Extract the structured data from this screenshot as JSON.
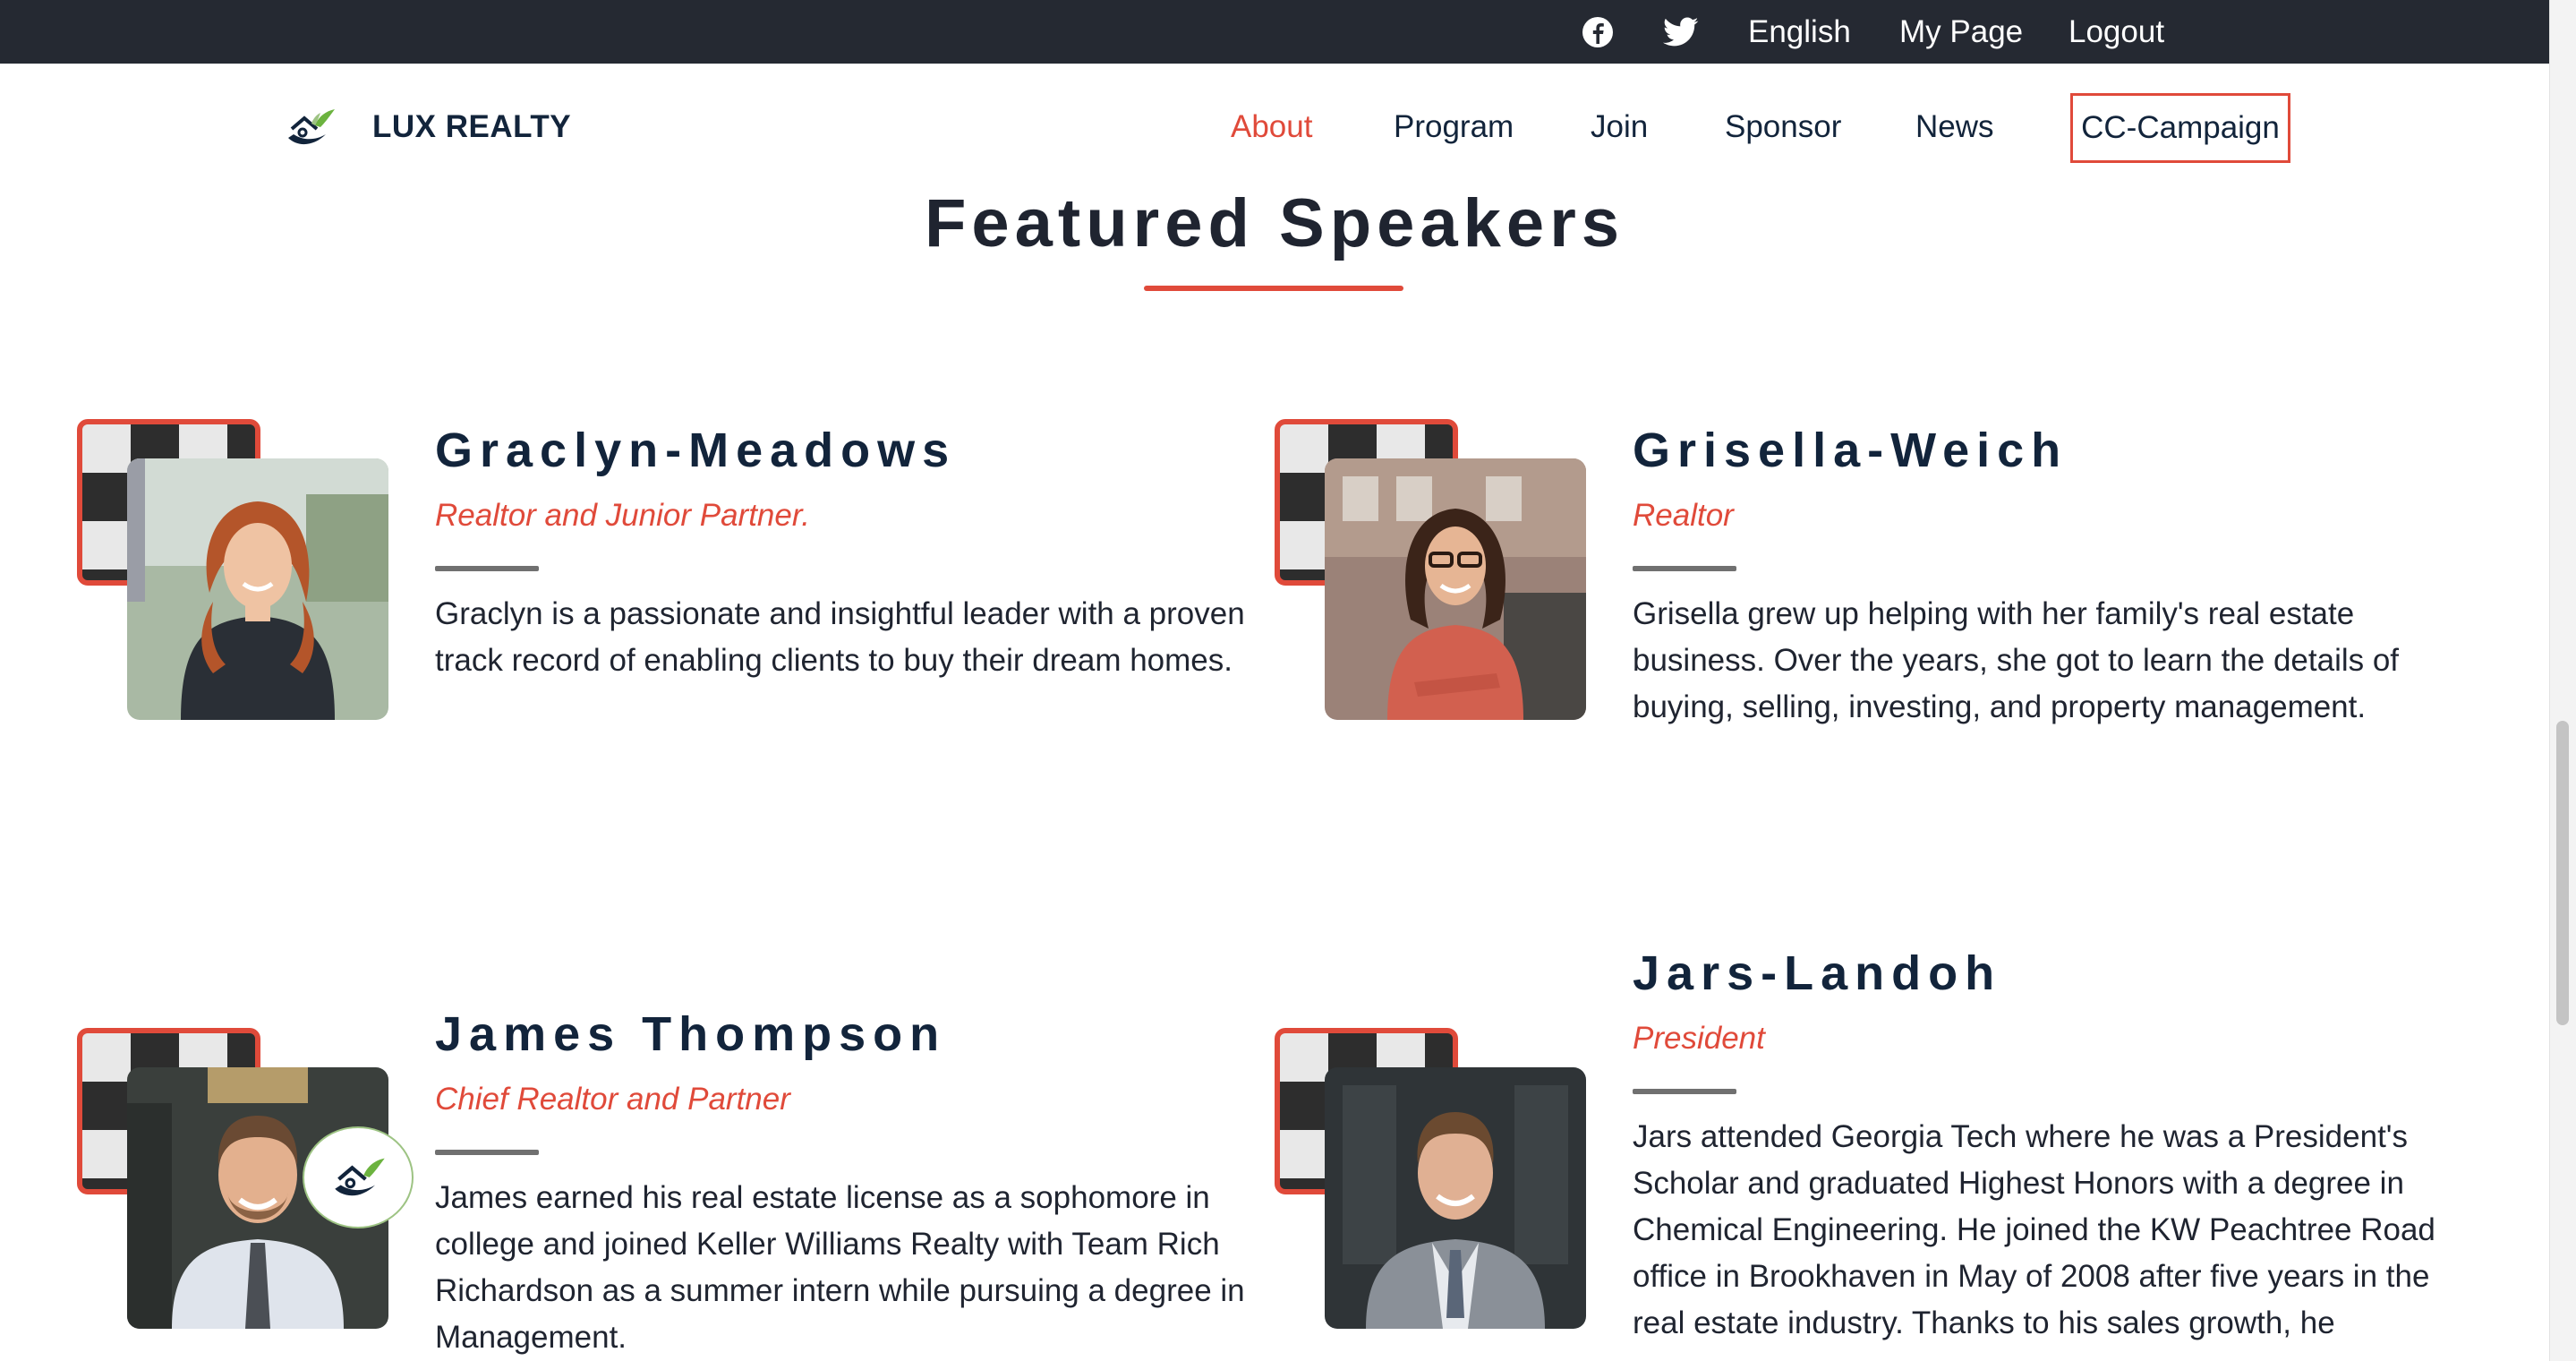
{
  "top_bar": {
    "facebook_icon": "facebook-icon",
    "twitter_icon": "twitter-icon",
    "language": "English",
    "my_page": "My Page",
    "logout": "Logout"
  },
  "nav": {
    "brand": "LUX REALTY",
    "items": [
      "About",
      "Program",
      "Join",
      "Sponsor",
      "News"
    ],
    "active": "About",
    "cta": "CC-Campaign"
  },
  "section": {
    "title": "Featured Speakers"
  },
  "speakers": [
    {
      "name": "Graclyn-Meadows",
      "role": "Realtor and Junior Partner.",
      "bio": "Graclyn is a passionate and insightful leader with a proven track record of enabling clients to buy their dream homes."
    },
    {
      "name": "Grisella-Weich",
      "role": "Realtor",
      "bio": "Grisella grew up helping with her family's real estate business. Over the years, she got to learn the details of buying, selling, investing, and property management."
    },
    {
      "name": "James Thompson",
      "role": "Chief Realtor and Partner",
      "bio": "James earned his real estate license as a sophomore in college and joined Keller Williams Realty with Team Rich Richardson as a summer intern while pursuing a degree in Management."
    },
    {
      "name": "Jars-Landoh",
      "role": "President",
      "bio": "Jars attended Georgia Tech where he was a President's Scholar and graduated Highest Honors with a degree in Chemical Engineering. He joined the KW Peachtree Road office in Brookhaven in May of 2008 after five years in the real estate industry. Thanks to his sales growth, he"
    }
  ],
  "colors": {
    "accent": "#e04a3a",
    "navy": "#12243b",
    "topbar": "#252932"
  }
}
